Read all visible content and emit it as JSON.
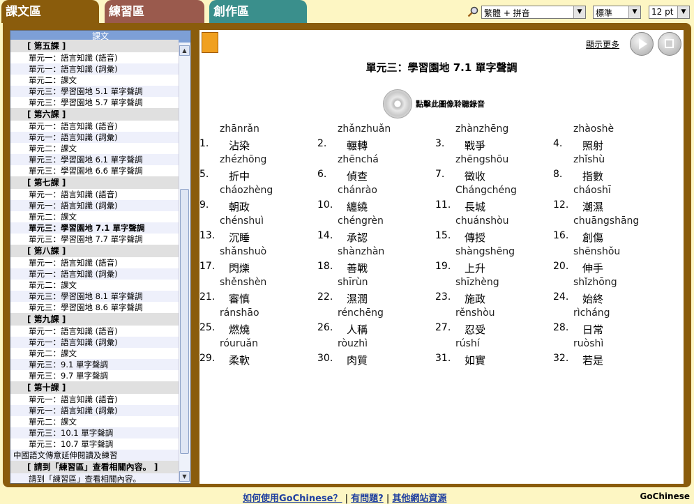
{
  "tabs": [
    {
      "label": "課文區"
    },
    {
      "label": "練習區"
    },
    {
      "label": "創作區"
    }
  ],
  "toolbar": {
    "display_mode": "繁體 + 拼音",
    "voice": "標準",
    "font_size": "12 pt"
  },
  "sidebar": {
    "header": "課文",
    "items": [
      {
        "type": "head",
        "label": "[ 第五課 ]"
      },
      {
        "type": "item",
        "label": "單元一：語言知識 (語音)"
      },
      {
        "type": "item",
        "label": "單元一：語言知識 (詞彙)"
      },
      {
        "type": "item",
        "label": "單元二：課文"
      },
      {
        "type": "item",
        "label": "單元三：學習園地 5.1 單字聲調"
      },
      {
        "type": "item",
        "label": "單元三：學習園地 5.7 單字聲調"
      },
      {
        "type": "head",
        "label": "[ 第六課 ]"
      },
      {
        "type": "item",
        "label": "單元一：語言知識 (語音)"
      },
      {
        "type": "item",
        "label": "單元一：語言知識 (詞彙)"
      },
      {
        "type": "item",
        "label": "單元二：課文"
      },
      {
        "type": "item",
        "label": "單元三：學習園地 6.1 單字聲調"
      },
      {
        "type": "item",
        "label": "單元三：學習園地 6.6 單字聲調"
      },
      {
        "type": "head",
        "label": "[ 第七課 ]"
      },
      {
        "type": "item",
        "label": "單元一：語言知識 (語音)"
      },
      {
        "type": "item",
        "label": "單元一：語言知識 (詞彙)"
      },
      {
        "type": "item",
        "label": "單元二：課文"
      },
      {
        "type": "cur",
        "label": "單元三：學習園地 7.1 單字聲調"
      },
      {
        "type": "item",
        "label": "單元三：學習園地 7.7 單字聲調"
      },
      {
        "type": "head",
        "label": "[ 第八課 ]"
      },
      {
        "type": "item",
        "label": "單元一：語言知識 (語音)"
      },
      {
        "type": "item",
        "label": "單元一：語言知識 (詞彙)"
      },
      {
        "type": "item",
        "label": "單元二：課文"
      },
      {
        "type": "item",
        "label": "單元三：學習園地 8.1 單字聲調"
      },
      {
        "type": "item",
        "label": "單元三：學習園地 8.6 單字聲調"
      },
      {
        "type": "head",
        "label": "[ 第九課 ]"
      },
      {
        "type": "item",
        "label": "單元一：語言知識 (語音)"
      },
      {
        "type": "item",
        "label": "單元一：語言知識 (詞彙)"
      },
      {
        "type": "item",
        "label": "單元二：課文"
      },
      {
        "type": "item",
        "label": "單元三：9.1 單字聲調"
      },
      {
        "type": "item",
        "label": "單元三：9.7 單字聲調"
      },
      {
        "type": "head",
        "label": "[ 第十課 ]"
      },
      {
        "type": "item",
        "label": "單元一：語言知識 (語音)"
      },
      {
        "type": "item",
        "label": "單元一：語言知識 (詞彙)"
      },
      {
        "type": "item",
        "label": "單元二：課文"
      },
      {
        "type": "item",
        "label": "單元三：10.1 單字聲調"
      },
      {
        "type": "item",
        "label": "單元三：10.7 單字聲調"
      },
      {
        "type": "wide",
        "label": "中國語文傳意延伸閱讀及練習"
      },
      {
        "type": "head",
        "label": "[ 請到「練習區」查看相關內容。 ]"
      },
      {
        "type": "item",
        "label": "請到「練習區」查看相關內容。"
      }
    ]
  },
  "main": {
    "show_more": "顯示更多",
    "title": "單元三：學習園地 7.1 單字聲調",
    "audio_prompt": "點擊此圖像聆聽錄音",
    "words": [
      {
        "num": "1.",
        "pinyin": "zhānrǎn",
        "hanzi": "沾染"
      },
      {
        "num": "2.",
        "pinyin": "zhǎnzhuǎn",
        "hanzi": "輾轉"
      },
      {
        "num": "3.",
        "pinyin": "zhànzhēng",
        "hanzi": "戰爭"
      },
      {
        "num": "4.",
        "pinyin": "zhàoshè",
        "hanzi": "照射"
      },
      {
        "num": "5.",
        "pinyin": "zhézhōng",
        "hanzi": "折中"
      },
      {
        "num": "6.",
        "pinyin": "zhēnchá",
        "hanzi": "偵查"
      },
      {
        "num": "7.",
        "pinyin": "zhēngshōu",
        "hanzi": "徵收"
      },
      {
        "num": "8.",
        "pinyin": "zhǐshù",
        "hanzi": "指數"
      },
      {
        "num": "9.",
        "pinyin": "cháozhèng",
        "hanzi": "朝政"
      },
      {
        "num": "10.",
        "pinyin": "chánrào",
        "hanzi": "纏繞"
      },
      {
        "num": "11.",
        "pinyin": "Chángchéng",
        "hanzi": "長城"
      },
      {
        "num": "12.",
        "pinyin": "cháoshī",
        "hanzi": "潮濕"
      },
      {
        "num": "13.",
        "pinyin": "chénshuì",
        "hanzi": "沉睡"
      },
      {
        "num": "14.",
        "pinyin": "chéngrèn",
        "hanzi": "承認"
      },
      {
        "num": "15.",
        "pinyin": "chuánshòu",
        "hanzi": "傳授"
      },
      {
        "num": "16.",
        "pinyin": "chuāngshāng",
        "hanzi": "創傷"
      },
      {
        "num": "17.",
        "pinyin": "shǎnshuò",
        "hanzi": "閃爍"
      },
      {
        "num": "18.",
        "pinyin": "shànzhàn",
        "hanzi": "善戰"
      },
      {
        "num": "19.",
        "pinyin": "shàngshēng",
        "hanzi": "上升"
      },
      {
        "num": "20.",
        "pinyin": "shēnshǒu",
        "hanzi": "伸手"
      },
      {
        "num": "21.",
        "pinyin": "shěnshèn",
        "hanzi": "審慎"
      },
      {
        "num": "22.",
        "pinyin": "shīrùn",
        "hanzi": "濕潤"
      },
      {
        "num": "23.",
        "pinyin": "shīzhèng",
        "hanzi": "施政"
      },
      {
        "num": "24.",
        "pinyin": "shǐzhōng",
        "hanzi": "始終"
      },
      {
        "num": "25.",
        "pinyin": "ránshāo",
        "hanzi": "燃燒"
      },
      {
        "num": "26.",
        "pinyin": "rénchēng",
        "hanzi": "人稱"
      },
      {
        "num": "27.",
        "pinyin": "rěnshòu",
        "hanzi": "忍受"
      },
      {
        "num": "28.",
        "pinyin": "rìcháng",
        "hanzi": "日常"
      },
      {
        "num": "29.",
        "pinyin": "róuruǎn",
        "hanzi": "柔軟"
      },
      {
        "num": "30.",
        "pinyin": "ròuzhì",
        "hanzi": "肉質"
      },
      {
        "num": "31.",
        "pinyin": "rúshí",
        "hanzi": "如實"
      },
      {
        "num": "32.",
        "pinyin": "ruòshì",
        "hanzi": "若是"
      }
    ]
  },
  "footer": {
    "link1": "如何使用GoChinese？",
    "sep": "|",
    "link2": "有問題?",
    "link3": "其他網站資源",
    "brand": "GoChinese"
  }
}
